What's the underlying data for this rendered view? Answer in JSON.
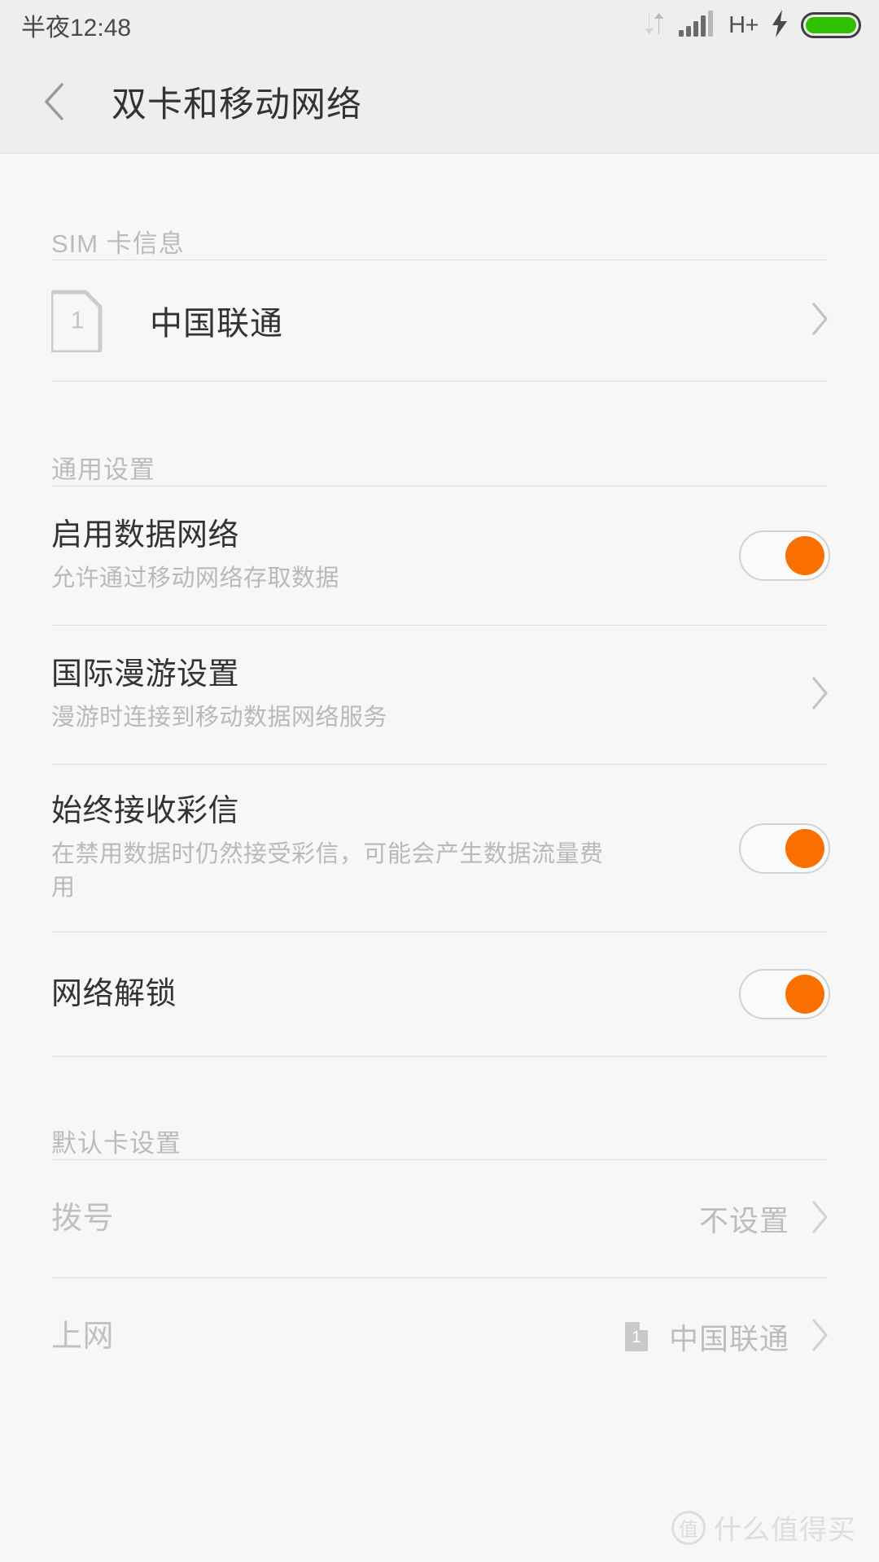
{
  "statusbar": {
    "clock": "半夜12:48",
    "network_type": "H+",
    "icons": {
      "data_transfer": "data-transfer-icon",
      "signal": "signal-bars-icon",
      "charging": "charging-bolt-icon",
      "battery": "battery-full-icon"
    },
    "battery_color": "#2fc000",
    "battery_level_percent": 100
  },
  "titlebar": {
    "back": "back-chevron-icon",
    "title": "双卡和移动网络"
  },
  "sections": {
    "sim_info": {
      "header": "SIM 卡信息",
      "sim": {
        "slot": "1",
        "carrier": "中国联通"
      }
    },
    "common": {
      "header": "通用设置",
      "items": [
        {
          "title": "启用数据网络",
          "subtitle": "允许通过移动网络存取数据",
          "control": "toggle",
          "state": "on"
        },
        {
          "title": "国际漫游设置",
          "subtitle": "漫游时连接到移动数据网络服务",
          "control": "chevron",
          "state": ""
        },
        {
          "title": "始终接收彩信",
          "subtitle": "在禁用数据时仍然接受彩信，可能会产生数据流量费用",
          "control": "toggle",
          "state": "on"
        },
        {
          "title": "网络解锁",
          "subtitle": "",
          "control": "toggle",
          "state": "on"
        }
      ]
    },
    "default_card": {
      "header": "默认卡设置",
      "items": [
        {
          "title": "拨号",
          "value": "不设置",
          "badge": ""
        },
        {
          "title": "上网",
          "value": "中国联通",
          "badge": "1"
        }
      ]
    }
  },
  "accent_color": "#f97000",
  "watermark": {
    "logo": "值",
    "text": "什么值得买"
  }
}
